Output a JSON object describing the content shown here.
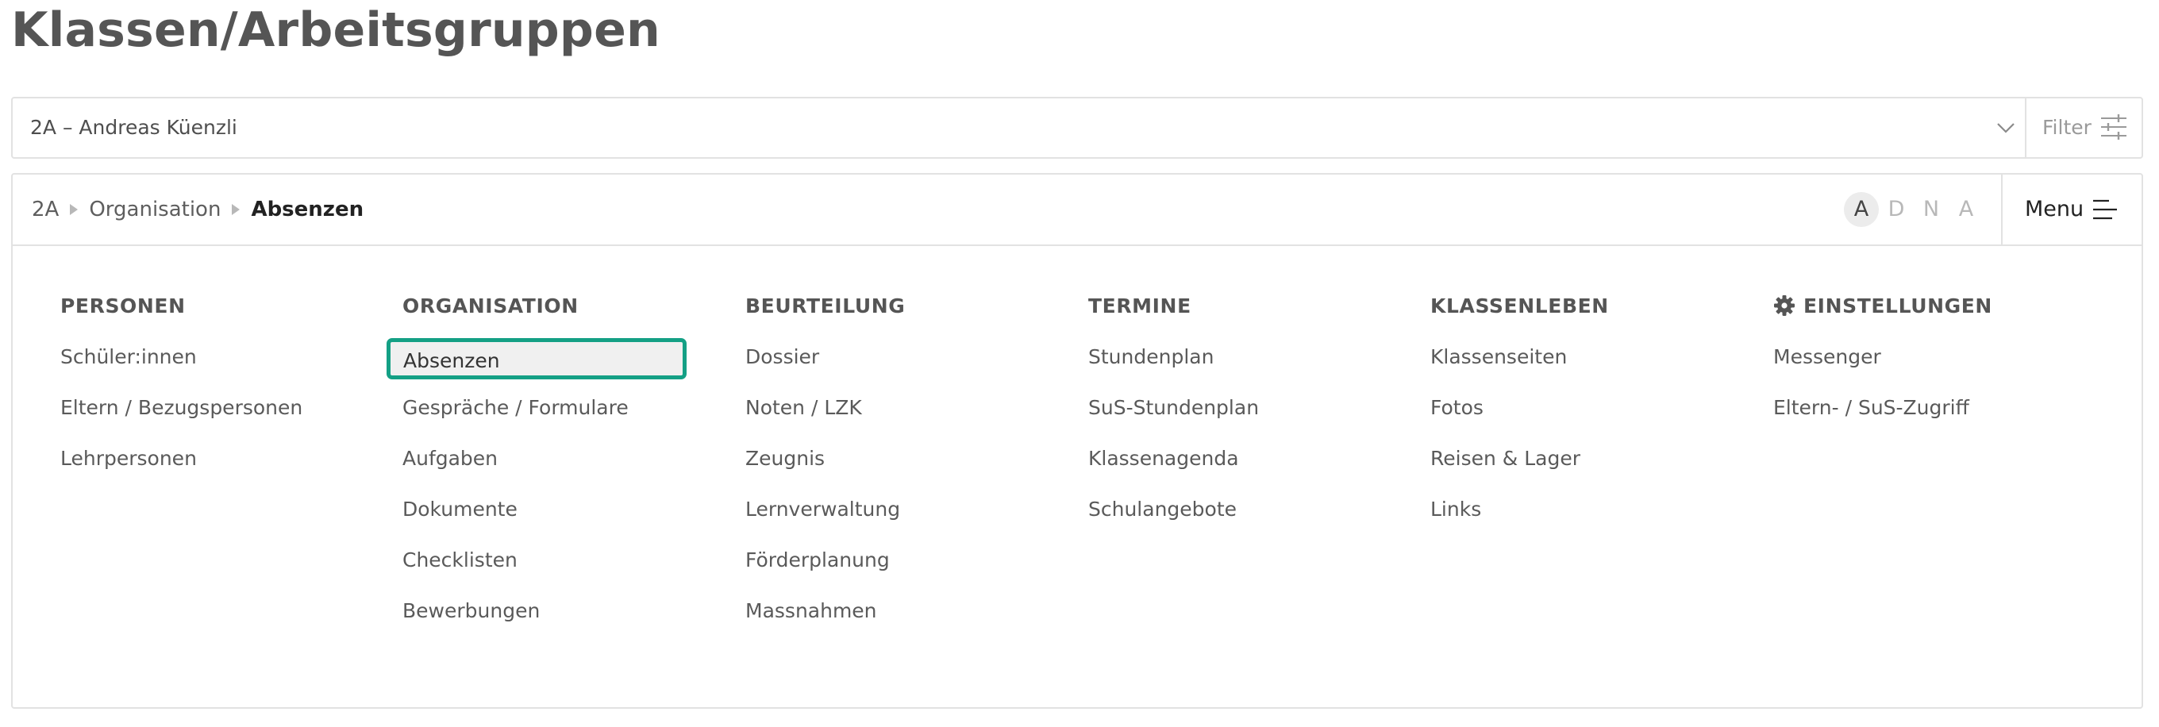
{
  "page": {
    "title": "Klassen/Arbeitsgruppen"
  },
  "selector": {
    "value": "2A – Andreas Küenzli",
    "filter_label": "Filter",
    "icons": {
      "chevron": "chevron-down-icon",
      "filter": "sliders-icon"
    }
  },
  "breadcrumb": {
    "items": [
      "2A",
      "Organisation",
      "Absenzen"
    ]
  },
  "view_toggles": {
    "items": [
      "A",
      "D",
      "N",
      "A"
    ],
    "active_index": 0
  },
  "menu": {
    "label": "Menu",
    "icon": "menu-lines-icon"
  },
  "columns": [
    {
      "heading": "PERSONEN",
      "items": [
        "Schüler:innen",
        "Eltern / Bezugspersonen",
        "Lehrpersonen"
      ]
    },
    {
      "heading": "ORGANISATION",
      "items": [
        "Absenzen",
        "Gespräche / Formulare",
        "Aufgaben",
        "Dokumente",
        "Checklisten",
        "Bewerbungen"
      ],
      "selected": "Absenzen"
    },
    {
      "heading": "BEURTEILUNG",
      "items": [
        "Dossier",
        "Noten / LZK",
        "Zeugnis",
        "Lernverwaltung",
        "Förderplanung",
        "Massnahmen"
      ]
    },
    {
      "heading": "TERMINE",
      "items": [
        "Stundenplan",
        "SuS-Stundenplan",
        "Klassenagenda",
        "Schulangebote"
      ]
    },
    {
      "heading": "KLASSENLEBEN",
      "items": [
        "Klassenseiten",
        "Fotos",
        "Reisen & Lager",
        "Links"
      ]
    },
    {
      "heading": "EINSTELLUNGEN",
      "heading_icon": "gear-icon",
      "items": [
        "Messenger",
        "Eltern- / SuS-Zugriff"
      ]
    }
  ],
  "colors": {
    "selection_border": "#14a085",
    "selection_background": "#f0f0f0",
    "border": "#e2e2e2",
    "text": "#5a5a5a"
  }
}
